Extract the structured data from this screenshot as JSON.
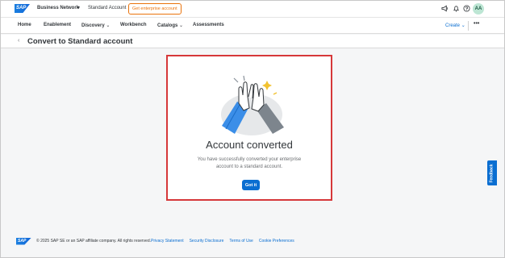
{
  "shell": {
    "logo": "SAP",
    "product": "Business Network",
    "product_caret": "▼",
    "account_type": "Standard Account",
    "upgrade_button": "Get enterprise account",
    "avatar_initials": "AA"
  },
  "nav": {
    "items": [
      "Home",
      "Enablement",
      "Discovery",
      "Workbench",
      "Catalogs",
      "Assessments"
    ],
    "dropdown_caret": "⌄",
    "create": "Create",
    "create_caret": "⌄",
    "more": "•••"
  },
  "page": {
    "back": "‹",
    "title": "Convert to Standard account"
  },
  "dialog": {
    "heading": "Account converted",
    "message": "You have successfully converted your enterprise account to a standard account.",
    "button": "Got it"
  },
  "feedback": "Feedback",
  "footer": {
    "logo": "SAP",
    "copyright": "© 2025 SAP SE or an SAP affiliate company. All rights reserved.",
    "links": [
      "Privacy Statement",
      "Security Disclosure",
      "Terms of Use",
      "Cookie Preferences"
    ]
  },
  "colors": {
    "brand_blue": "#0a6ed1",
    "upgrade_orange": "#e9730c",
    "highlight_red": "#d6383a",
    "avatar_green": "#bde6d4"
  }
}
